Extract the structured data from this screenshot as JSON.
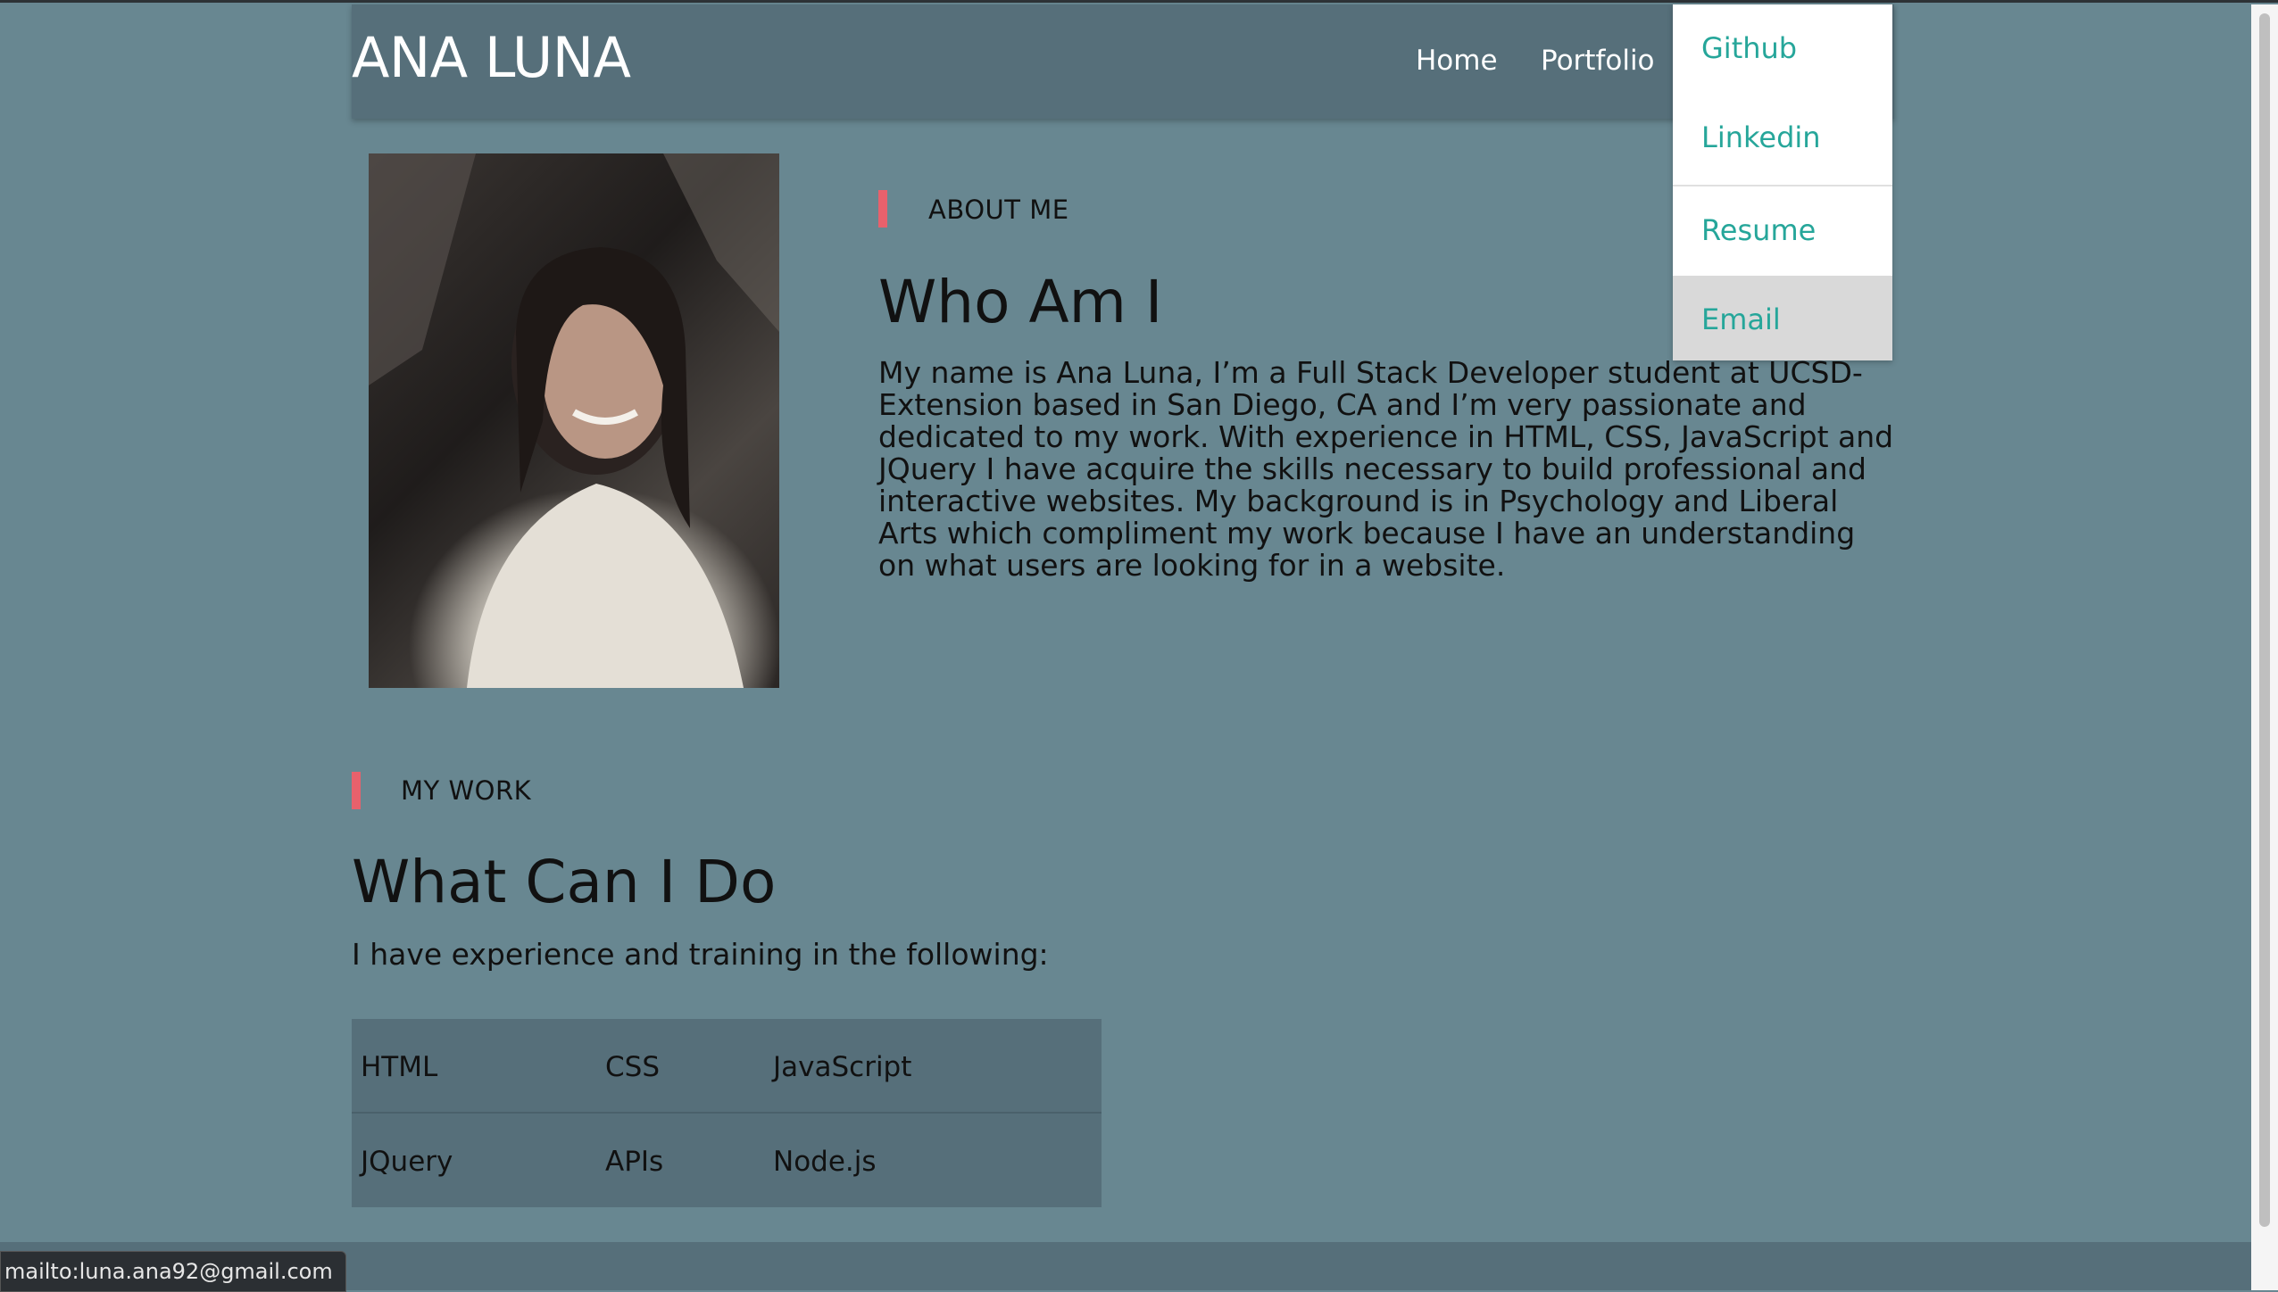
{
  "header": {
    "brand": "ANA LUNA",
    "nav": [
      "Home",
      "Portfolio"
    ]
  },
  "dropdown": {
    "items": [
      "Github",
      "Linkedin",
      "Resume",
      "Email"
    ],
    "active_item": "Email"
  },
  "about": {
    "kicker": "ABOUT ME",
    "title": "Who Am I",
    "text": "My name is Ana Luna, I’m a Full Stack Developer student at UCSD-Extension based in San Diego, CA and I’m very passionate and dedicated to my work. With experience in HTML, CSS, JavaScript and JQuery I have acquire the skills necessary to build professional and interactive websites. My background is in Psychology and Liberal Arts which compliment my work because I have an understanding on what users are looking for in a website."
  },
  "work": {
    "kicker": "MY WORK",
    "title": "What Can I Do",
    "subtitle": "I have experience and training in the following:",
    "skills": [
      [
        "HTML",
        "CSS",
        "JavaScript"
      ],
      [
        "JQuery",
        "APIs",
        "Node.js"
      ]
    ]
  },
  "status_bar": {
    "url": "mailto:luna.ana92@gmail.com"
  },
  "colors": {
    "page_bg": "#688791",
    "navbar_bg": "#566f7a",
    "accent": "#e8616c",
    "link": "#26a69a"
  }
}
